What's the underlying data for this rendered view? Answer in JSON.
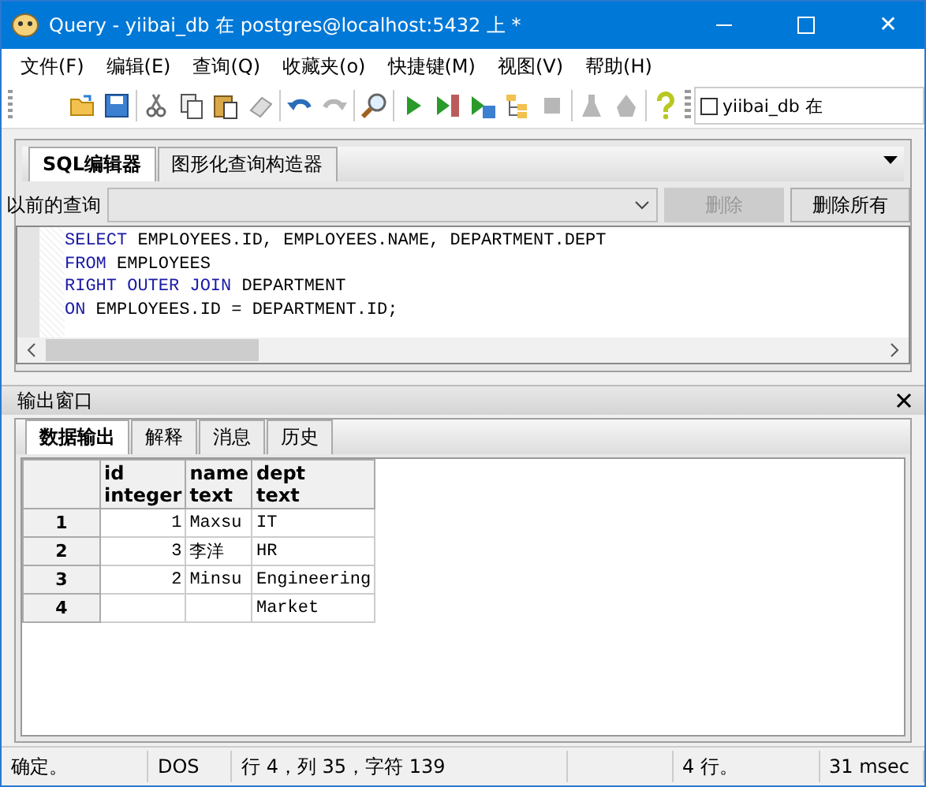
{
  "window": {
    "title": "Query - yiibai_db 在  postgres@localhost:5432 上 *",
    "close_icon": "✕"
  },
  "menu": [
    "文件(F)",
    "编辑(E)",
    "查询(Q)",
    "收藏夹(o)",
    "快捷键(M)",
    "视图(V)",
    "帮助(H)"
  ],
  "toolbar": [
    {
      "disabled": false
    },
    {
      "disabled": false
    },
    {
      "disabled": false
    },
    {
      "disabled": false
    },
    {
      "disabled": false
    },
    {
      "disabled": false
    },
    {
      "disabled": false
    },
    {
      "disabled": true
    },
    {
      "disabled": false
    },
    {
      "disabled": false
    },
    {
      "disabled": false
    },
    {
      "disabled": false
    },
    {
      "disabled": false
    },
    {
      "disabled": true
    },
    {
      "disabled": true
    },
    {
      "disabled": true
    },
    {
      "disabled": false
    }
  ],
  "database_selector": {
    "label": "yiibai_db 在",
    "checked": false
  },
  "editor_tabs": [
    {
      "label": "SQL编辑器",
      "selected": true
    },
    {
      "label": "图形化查询构造器",
      "selected": false
    }
  ],
  "previous_queries": {
    "label": "以前的查询",
    "buttons": [
      {
        "label": "删除",
        "disabled": true
      },
      {
        "label": "删除所有",
        "disabled": false
      }
    ]
  },
  "sql": [
    {
      "keyword": "SELECT",
      "rest": " EMPLOYEES.ID, EMPLOYEES.NAME, DEPARTMENT.DEPT"
    },
    {
      "keyword": "FROM",
      "rest": " EMPLOYEES"
    },
    {
      "keyword": "RIGHT OUTER JOIN",
      "rest": " DEPARTMENT"
    },
    {
      "keyword": "ON",
      "rest": " EMPLOYEES.ID = DEPARTMENT.ID;"
    }
  ],
  "output": {
    "title": "输出窗口",
    "tabs": [
      {
        "label": "数据输出",
        "selected": true
      },
      {
        "label": "解释",
        "selected": false
      },
      {
        "label": "消息",
        "selected": false
      },
      {
        "label": "历史",
        "selected": false
      }
    ],
    "columns": [
      {
        "name": "id",
        "type": "integer"
      },
      {
        "name": "name",
        "type": "text"
      },
      {
        "name": "dept",
        "type": "text"
      }
    ],
    "rows": [
      {
        "number": "1",
        "cells": [
          "1",
          "Maxsu",
          "IT"
        ]
      },
      {
        "number": "2",
        "cells": [
          "3",
          "李洋",
          "HR"
        ]
      },
      {
        "number": "3",
        "cells": [
          "2",
          "Minsu",
          "Engineering"
        ]
      },
      {
        "number": "4",
        "cells": [
          "",
          "",
          "Market"
        ]
      }
    ]
  },
  "status_bar": [
    "确定。",
    "DOS",
    "行 4，列 35，字符 139",
    "4 行。",
    "31 msec"
  ]
}
